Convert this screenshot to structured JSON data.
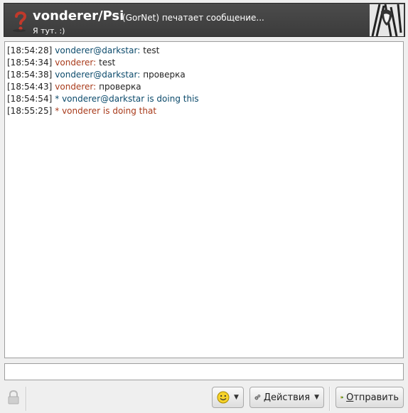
{
  "header": {
    "contact_name": "vonderer/Psi",
    "typing_status": "(GorNet) печатает сообщение...",
    "status_message": "Я тут. :)"
  },
  "messages": [
    {
      "time": "[18:54:28]",
      "sender": "vonderer@darkstar:",
      "text": "test",
      "kind": "self"
    },
    {
      "time": "[18:54:34]",
      "sender": "vonderer:",
      "text": "test",
      "kind": "other"
    },
    {
      "time": "[18:54:38]",
      "sender": "vonderer@darkstar:",
      "text": "проверка",
      "kind": "self"
    },
    {
      "time": "[18:54:43]",
      "sender": "vonderer:",
      "text": "проверка",
      "kind": "other"
    },
    {
      "time": "[18:54:54]",
      "sender": "* vonderer@darkstar is doing this",
      "text": "",
      "kind": "self"
    },
    {
      "time": "[18:55:25]",
      "sender": "* vonderer is doing that",
      "text": "",
      "kind": "other"
    }
  ],
  "input": {
    "value": ""
  },
  "toolbar": {
    "actions_first": "Д",
    "actions_rest": "ействия",
    "send_first": "О",
    "send_rest": "тправить"
  },
  "colors": {
    "self_sender": "#0b4a6b",
    "other_sender": "#a83a1a",
    "header_bg": "#404040"
  },
  "icons": [
    "status-question-icon",
    "avatar-image",
    "lock-icon",
    "smiley-icon",
    "gears-icon",
    "send-arrow-icon",
    "chevron-down-icon"
  ]
}
